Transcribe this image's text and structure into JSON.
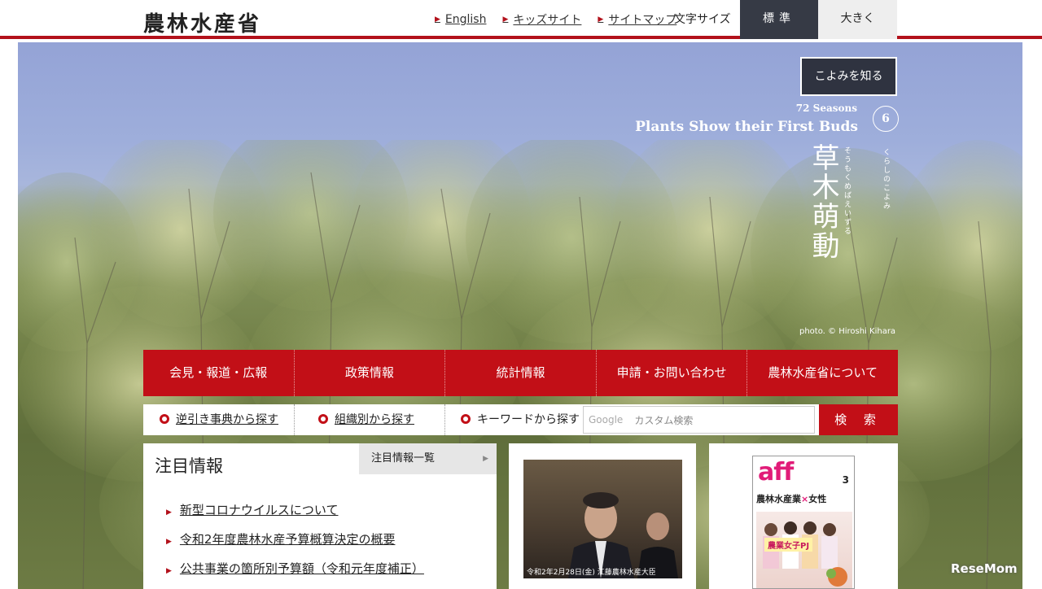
{
  "header": {
    "logo": "農林水産省",
    "links": [
      {
        "label": "English"
      },
      {
        "label": "キッズサイト"
      },
      {
        "label": "サイトマップ"
      }
    ],
    "font_size_label": "文字サイズ",
    "font_size_standard": "標準",
    "font_size_large": "大きく"
  },
  "hero": {
    "koyomi_button": "こよみを知る",
    "season_series": "72 Seasons",
    "season_title_en": "Plants Show their First Buds",
    "season_number": "6",
    "season_title_jp": "草木萌動",
    "season_ruby": "そうもくめばえいずる",
    "season_ruby_label": "くらしのこよみ",
    "photo_credit": "photo. © Hiroshi Kihara"
  },
  "main_nav": {
    "items": [
      {
        "label": "会見・報道・広報"
      },
      {
        "label": "政策情報"
      },
      {
        "label": "統計情報"
      },
      {
        "label": "申請・お問い合わせ"
      },
      {
        "label": "農林水産省について"
      }
    ]
  },
  "search": {
    "reverse_dictionary": "逆引き事典から探す",
    "by_organization": "組織別から探す",
    "keyword_label": "キーワードから探す",
    "google_label": "Google",
    "placeholder": "カスタム検索",
    "button": "検 索"
  },
  "featured": {
    "title": "注目情報",
    "list_button": "注目情報一覧",
    "items": [
      {
        "label": "新型コロナウイルスについて"
      },
      {
        "label": "令和2年度農林水産予算概算決定の概要"
      },
      {
        "label": "公共事業の箇所別予算額（令和元年度補正）"
      }
    ]
  },
  "video": {
    "caption": "令和2年2月28日(金) 江藤農林水産大臣"
  },
  "magazine": {
    "title": "aff",
    "issue": "3",
    "headline_a": "農林水産業",
    "headline_x": "×",
    "headline_b": "女性",
    "banner": "農業女子PJ"
  },
  "watermark": "ReseMom",
  "colors": {
    "brand_red": "#c20f17",
    "header_rule": "#b3111b",
    "dark_button": "#363a45"
  }
}
